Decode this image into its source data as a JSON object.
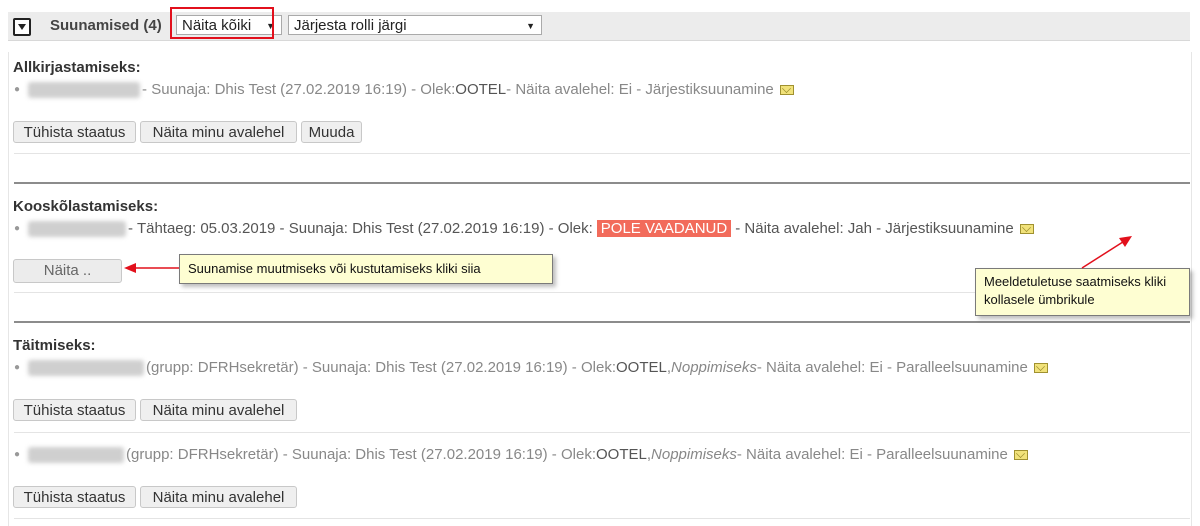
{
  "header": {
    "title": "Suunamised (4)",
    "show_select": "Näita kõiki",
    "order_select": "Järjesta rolli järgi"
  },
  "sections": [
    {
      "heading": "Allkirjastamiseks:",
      "entries": [
        {
          "text": "- Suunaja: Dhis Test (27.02.2019 16:19) - Olek: ",
          "status": "OOTEL",
          "rest": " - Näita avalehel: Ei - Järjestiksuunamine",
          "buttons": [
            "Tühista staatus",
            "Näita minu avalehel",
            "Muuda"
          ]
        }
      ]
    },
    {
      "heading": "Kooskõlastamiseks:",
      "entries": [
        {
          "text": "- Tähtaeg: 05.03.2019 - Suunaja: Dhis Test (27.02.2019 16:19) - Olek: ",
          "status": "POLE VAADANUD",
          "rest": " - Näita avalehel: Jah - Järjestiksuunamine",
          "buttons": [
            "Näita .."
          ]
        }
      ]
    },
    {
      "heading": "Täitmiseks:",
      "entries": [
        {
          "text": "(grupp: DFRHsekretär) - Suunaja: Dhis Test (27.02.2019 16:19) - Olek: ",
          "status": "OOTEL",
          "after_status": " , ",
          "italic": "Noppimiseks",
          "rest": " - Näita avalehel: Ei - Paralleelsuunamine",
          "buttons": [
            "Tühista staatus",
            "Näita minu avalehel"
          ]
        },
        {
          "text": "(grupp: DFRHsekretär) - Suunaja: Dhis Test (27.02.2019 16:19) - Olek: ",
          "status": "OOTEL",
          "after_status": " , ",
          "italic": "Noppimiseks",
          "rest": " - Näita avalehel: Ei - Paralleelsuunamine",
          "buttons": [
            "Tühista staatus",
            "Näita minu avalehel"
          ]
        }
      ]
    }
  ],
  "callouts": {
    "edit_tip": "Suunamise muutmiseks või kustutamiseks kliki siia",
    "reminder_tip": "Meeldetuletuse saatmiseks kliki kollasele ümbrikule"
  },
  "colors": {
    "status_badge": "#f26b5b",
    "highlight_box": "#e2101c",
    "callout_bg": "#fefed2",
    "arrow": "#e2101c"
  }
}
